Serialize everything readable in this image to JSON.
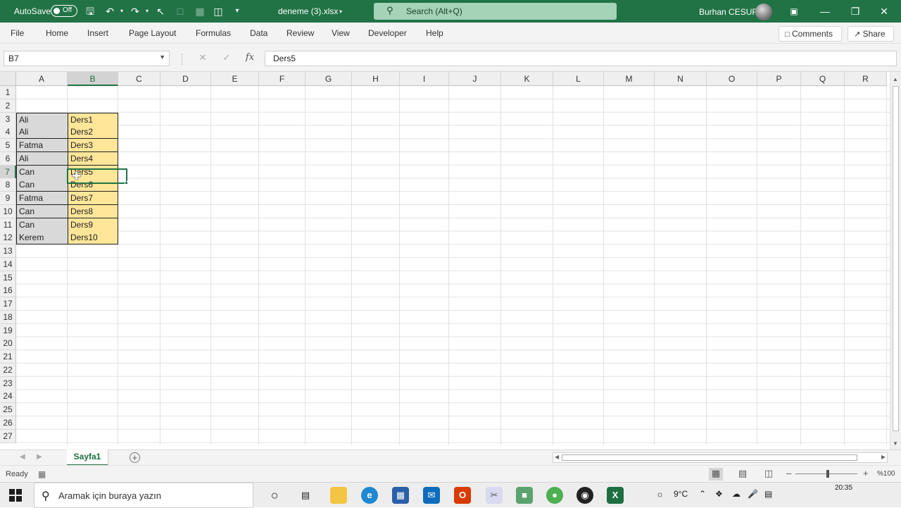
{
  "titlebar": {
    "autosave_label": "AutoSave",
    "autosave_state": "Off",
    "doc_title": "deneme (3).xlsx",
    "search_placeholder": "Search (Alt+Q)",
    "user_name": "Burhan CESUR"
  },
  "menu": [
    "File",
    "Home",
    "Insert",
    "Page Layout",
    "Formulas",
    "Data",
    "Review",
    "View",
    "Developer",
    "Help"
  ],
  "menu_right": {
    "comments": "Comments",
    "share": "Share"
  },
  "formula_bar": {
    "name_box": "B7",
    "fx": "fx",
    "value": "Ders5"
  },
  "columns": [
    "A",
    "B",
    "C",
    "D",
    "E",
    "F",
    "G",
    "H",
    "I",
    "J",
    "K",
    "L",
    "M",
    "N",
    "O",
    "P",
    "Q",
    "R"
  ],
  "rows": [
    "1",
    "2",
    "3",
    "4",
    "5",
    "6",
    "7",
    "8",
    "9",
    "10",
    "11",
    "12",
    "13",
    "14",
    "15",
    "16",
    "17",
    "18",
    "19",
    "20",
    "21",
    "22",
    "23",
    "24",
    "25",
    "26",
    "27"
  ],
  "selected_cell": {
    "column": "B",
    "row": "7"
  },
  "table": [
    {
      "row": "3",
      "a": "Ali",
      "b": "Ders1"
    },
    {
      "row": "4",
      "a": "Ali",
      "b": "Ders2"
    },
    {
      "row": "5",
      "a": "Fatma",
      "b": "Ders3"
    },
    {
      "row": "6",
      "a": "Ali",
      "b": "Ders4"
    },
    {
      "row": "7",
      "a": "Can",
      "b": "Ders5"
    },
    {
      "row": "8",
      "a": "Can",
      "b": "Ders6"
    },
    {
      "row": "9",
      "a": "Fatma",
      "b": "Ders7"
    },
    {
      "row": "10",
      "a": "Can",
      "b": "Ders8"
    },
    {
      "row": "11",
      "a": "Can",
      "b": "Ders9"
    },
    {
      "row": "12",
      "a": "Kerem",
      "b": "Ders10"
    }
  ],
  "sheet_tabs": [
    "Sayfa1"
  ],
  "status": {
    "ready": "Ready",
    "zoom": "%100"
  },
  "taskbar": {
    "search_placeholder": "Aramak için buraya yazın",
    "weather": "9°C",
    "time": "20:35"
  },
  "colors": {
    "excel_green": "#217346",
    "cell_a_fill": "#d9d9d9",
    "cell_b_fill": "#ffe699"
  }
}
